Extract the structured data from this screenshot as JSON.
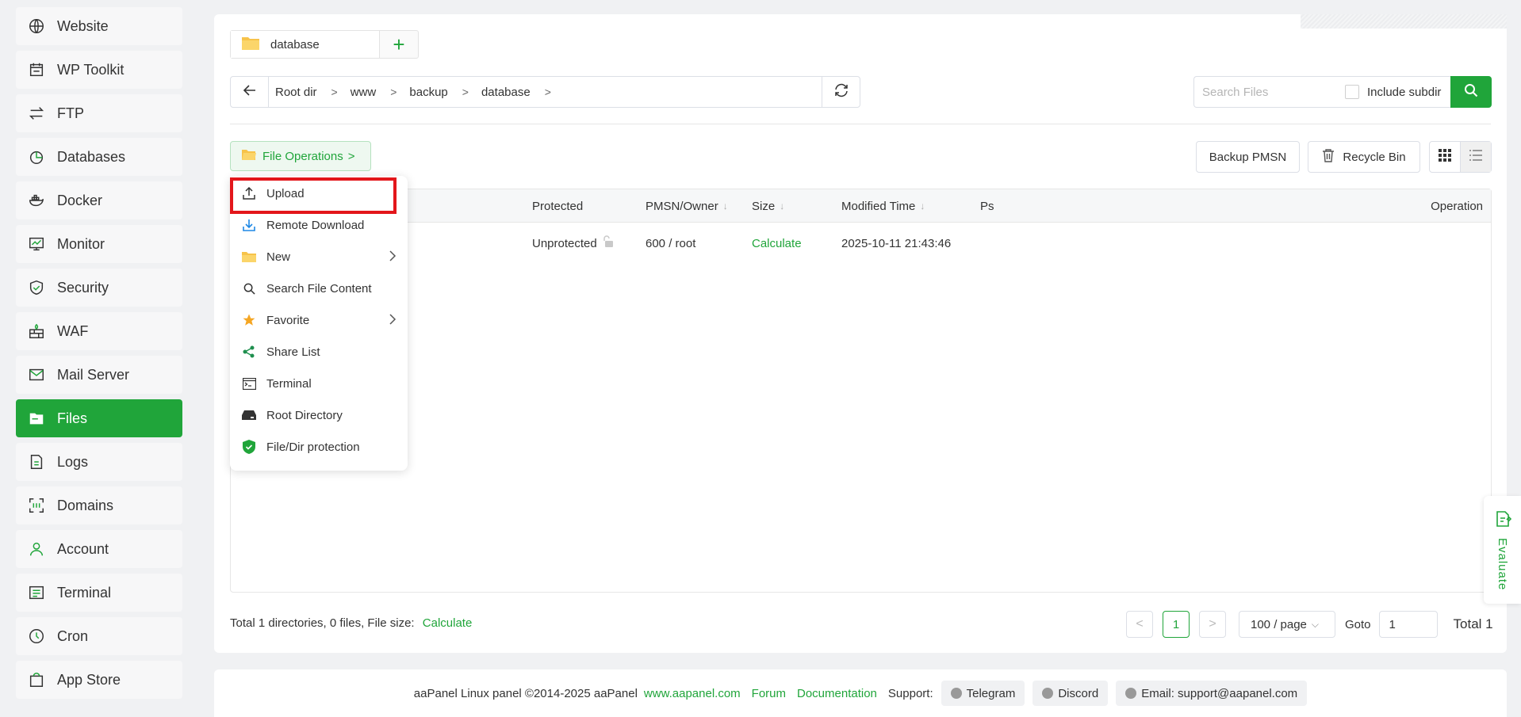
{
  "sidebar": {
    "items": [
      {
        "label": "Website",
        "icon": "globe-icon"
      },
      {
        "label": "WP Toolkit",
        "icon": "wp-toolkit-icon"
      },
      {
        "label": "FTP",
        "icon": "ftp-icon"
      },
      {
        "label": "Databases",
        "icon": "database-icon"
      },
      {
        "label": "Docker",
        "icon": "docker-icon"
      },
      {
        "label": "Monitor",
        "icon": "monitor-icon"
      },
      {
        "label": "Security",
        "icon": "shield-icon"
      },
      {
        "label": "WAF",
        "icon": "waf-icon"
      },
      {
        "label": "Mail Server",
        "icon": "mail-icon"
      },
      {
        "label": "Files",
        "icon": "folder-icon",
        "active": true
      },
      {
        "label": "Logs",
        "icon": "logs-icon"
      },
      {
        "label": "Domains",
        "icon": "domains-icon"
      },
      {
        "label": "Account",
        "icon": "user-icon"
      },
      {
        "label": "Terminal",
        "icon": "terminal-icon"
      },
      {
        "label": "Cron",
        "icon": "clock-icon"
      },
      {
        "label": "App Store",
        "icon": "app-store-icon"
      }
    ]
  },
  "tabs": {
    "current": "database",
    "add_icon": "plus-icon"
  },
  "path": {
    "crumbs": [
      "Root dir",
      "www",
      "backup",
      "database"
    ]
  },
  "search": {
    "placeholder": "Search Files",
    "include_label": "Include subdir"
  },
  "toolbar": {
    "file_operations": "File Operations",
    "backup": "Backup PMSN",
    "recycle": "Recycle Bin"
  },
  "table": {
    "headers": {
      "protected": "Protected",
      "pmsn": "PMSN/Owner",
      "size": "Size",
      "modified": "Modified Time",
      "ps": "Ps",
      "operation": "Operation"
    },
    "rows": [
      {
        "protected": "Unprotected",
        "pmsn": "600 / root",
        "size": "Calculate",
        "modified": "2025-10-11 21:43:46"
      }
    ]
  },
  "summary": {
    "text": "Total 1 directories, 0 files, File size:",
    "calc": "Calculate"
  },
  "pager": {
    "current": "1",
    "page_size": "100 / page",
    "goto_label": "Goto",
    "goto_value": "1",
    "total": "Total 1"
  },
  "menu": {
    "items": [
      {
        "label": "Upload",
        "icon": "upload-icon"
      },
      {
        "label": "Remote Download",
        "icon": "download-icon"
      },
      {
        "label": "New",
        "icon": "folder-icon",
        "submenu": true
      },
      {
        "label": "Search File Content",
        "icon": "search-icon"
      },
      {
        "label": "Favorite",
        "icon": "star-icon",
        "submenu": true
      },
      {
        "label": "Share List",
        "icon": "share-icon"
      },
      {
        "label": "Terminal",
        "icon": "terminal-icon"
      },
      {
        "label": "Root Directory",
        "icon": "drive-icon"
      },
      {
        "label": "File/Dir protection",
        "icon": "shield-check-icon"
      }
    ]
  },
  "evaluate": {
    "label": "Evaluate"
  },
  "footer": {
    "copyright": "aaPanel Linux panel ©2014-2025 aaPanel",
    "site": "www.aapanel.com",
    "forum": "Forum",
    "docs": "Documentation",
    "support": "Support:",
    "telegram": "Telegram",
    "discord": "Discord",
    "email": "Email: support@aapanel.com"
  },
  "colors": {
    "accent": "#20a53a",
    "highlight": "#e3161b"
  }
}
